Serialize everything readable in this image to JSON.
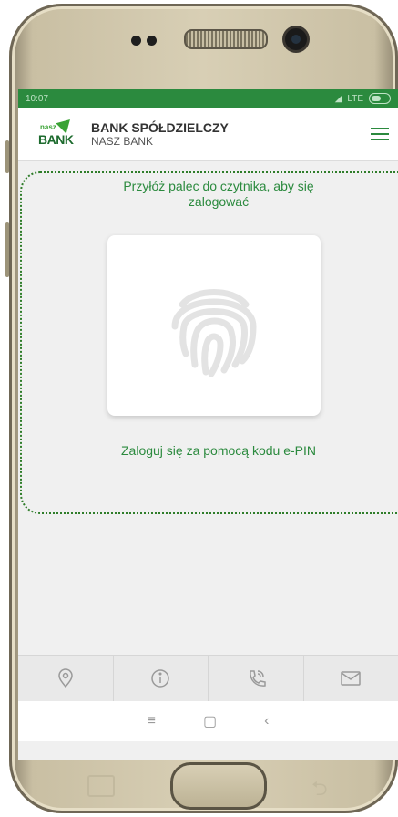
{
  "status_bar": {
    "time": "10:07",
    "network": "LTE"
  },
  "app_bar": {
    "logo_small": "nasz",
    "logo_big": "BANK",
    "bank_name": "BANK SPÓŁDZIELCZY",
    "bank_subname": "NASZ BANK",
    "menu_icon": "hamburger-icon"
  },
  "login": {
    "prompt": "Przyłóż palec do czytnika, aby się zalogować",
    "fingerprint_icon": "fingerprint-icon",
    "epin_link": "Zaloguj się za pomocą kodu e-PIN"
  },
  "bottom_nav": {
    "items": [
      {
        "icon": "location-icon"
      },
      {
        "icon": "info-icon"
      },
      {
        "icon": "phone-icon"
      },
      {
        "icon": "mail-icon"
      }
    ]
  },
  "system_nav": {
    "menu_glyph": "≡",
    "home_glyph": "▢",
    "back_glyph": "‹"
  },
  "colors": {
    "primary_green": "#2b8a3e",
    "dotted_outline": "#2f7d2a"
  }
}
